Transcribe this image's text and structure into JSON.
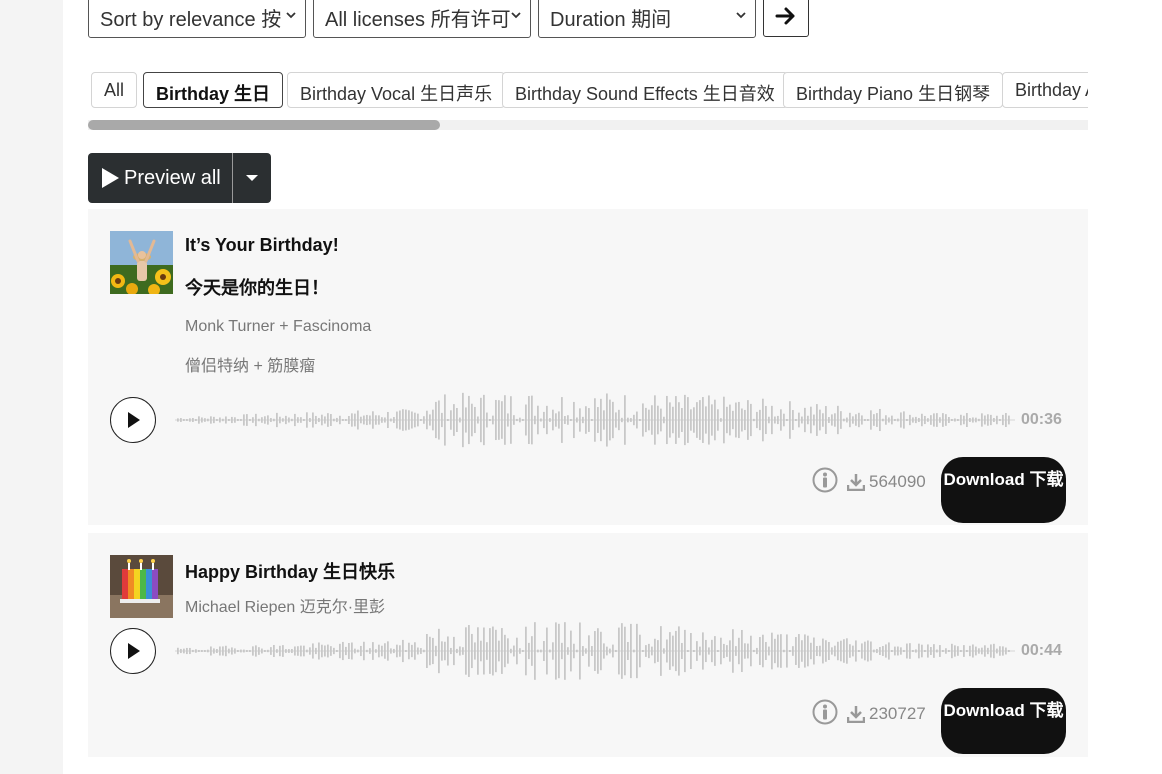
{
  "filters": {
    "sort": "Sort by relevance 按",
    "license": "All licenses 所有许可",
    "duration": "Duration 期间"
  },
  "tags": [
    {
      "label": "All"
    },
    {
      "label": "Birthday 生日",
      "active": true
    },
    {
      "label": "Birthday Vocal 生日声乐"
    },
    {
      "label": "Birthday Sound Effects 生日音效"
    },
    {
      "label": "Birthday Piano 生日钢琴"
    },
    {
      "label": "Birthday A"
    }
  ],
  "preview": {
    "label": "Preview all"
  },
  "tracks": [
    {
      "title": "It’s Your Birthday!",
      "title_cn": "今天是你的生日！",
      "artist": "Monk Turner + Fascinoma",
      "artist_cn": "僧侣特纳 + 筋膜瘤",
      "duration": "00:36",
      "downloads": "564090",
      "download_label": "Download 下载"
    },
    {
      "title": "Happy Birthday 生日快乐",
      "artist": "Michael Riepen 迈克尔·里彭",
      "duration": "00:44",
      "downloads": "230727",
      "download_label": "Download 下载"
    }
  ],
  "icons": {
    "play": "play-icon",
    "info": "info-icon",
    "download": "download-icon",
    "arrow": "arrow-right-icon",
    "chevron": "chevron-down-icon"
  },
  "colors": {
    "accent_dark": "#111111",
    "preview_bg": "#2b2f31",
    "card_bg": "#f7f7f7",
    "wave": "#c8c8c8"
  }
}
